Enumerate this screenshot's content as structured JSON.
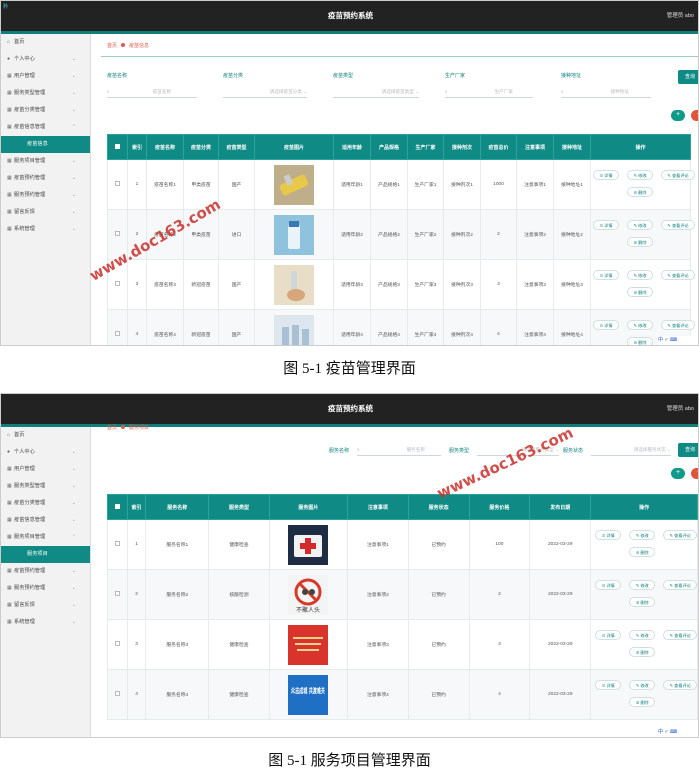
{
  "app": {
    "title": "疫苗预约系统",
    "user": "管理员 abo",
    "corner_mark": "矜"
  },
  "sidebar": {
    "items": [
      {
        "label": "首页",
        "icon": "home-icon",
        "glyph": "⌂"
      },
      {
        "label": "个人中心",
        "icon": "person-icon",
        "glyph": "●"
      },
      {
        "label": "用户管理",
        "icon": "grid-icon",
        "glyph": "▦"
      },
      {
        "label": "服务类型管理",
        "icon": "grid-icon",
        "glyph": "▦"
      },
      {
        "label": "疫苗分类管理",
        "icon": "grid-icon",
        "glyph": "▦"
      },
      {
        "label": "疫苗信息管理",
        "icon": "grid-icon",
        "glyph": "▦"
      },
      {
        "label": "服务项目管理",
        "icon": "grid-icon",
        "glyph": "▦"
      },
      {
        "label": "疫苗预约管理",
        "icon": "grid-icon",
        "glyph": "▦"
      },
      {
        "label": "服务预约管理",
        "icon": "grid-icon",
        "glyph": "▦"
      },
      {
        "label": "留言反馈",
        "icon": "grid-icon",
        "glyph": "▦"
      },
      {
        "label": "系统管理",
        "icon": "grid-icon",
        "glyph": "▦"
      }
    ],
    "sub_vaccine": "疫苗信息",
    "sub_service": "服务项目"
  },
  "screen1": {
    "breadcrumb": {
      "home": "首页",
      "current": "疫苗信息"
    },
    "filters": [
      {
        "label": "疫苗名称",
        "placeholder": "疫苗名称"
      },
      {
        "label": "疫苗分类",
        "placeholder": "请选择疫苗分类"
      },
      {
        "label": "疫苗类型",
        "placeholder": "请选择疫苗类型"
      },
      {
        "label": "生产厂家",
        "placeholder": "生产厂家"
      },
      {
        "label": "接种地址",
        "placeholder": "接种地址"
      }
    ],
    "query_button": "查询",
    "add_button": "+",
    "delete_button": "-",
    "columns": [
      "",
      "索引",
      "疫苗名称",
      "疫苗分类",
      "疫苗类型",
      "疫苗图片",
      "适用年龄",
      "产品规格",
      "生产厂家",
      "接种剂次",
      "疫苗总价",
      "注意事项",
      "接种地址",
      "操作"
    ],
    "rows": [
      [
        "1",
        "疫苗名称1",
        "甲类疫苗",
        "国产",
        "适用年龄1",
        "产品规格1",
        "生产厂家1",
        "接种剂次1",
        "1000",
        "注意事项1",
        "接种地址1"
      ],
      [
        "2",
        "疫苗名称2",
        "甲类疫苗",
        "进口",
        "适用年龄2",
        "产品规格2",
        "生产厂家2",
        "接种剂次2",
        "2",
        "注意事项2",
        "接种地址2"
      ],
      [
        "3",
        "疫苗名称3",
        "新冠疫苗",
        "国产",
        "适用年龄3",
        "产品规格3",
        "生产厂家3",
        "接种剂次3",
        "3",
        "注意事项3",
        "接种地址3"
      ],
      [
        "4",
        "疫苗名称4",
        "新冠疫苗",
        "国产",
        "适用年龄4",
        "产品规格4",
        "生产厂家4",
        "接种剂次4",
        "4",
        "注意事项4",
        "接种地址4"
      ]
    ]
  },
  "screen2": {
    "breadcrumb": {
      "home": "首页",
      "current": "服务项目"
    },
    "filters": [
      {
        "label": "服务名称",
        "placeholder": "服务名称"
      },
      {
        "label": "服务类型",
        "placeholder": "请选择服务类型"
      },
      {
        "label": "服务状态",
        "placeholder": "请选择服务状态"
      }
    ],
    "query_button": "查询",
    "add_button": "+",
    "delete_button": "-",
    "columns": [
      "",
      "索引",
      "服务名称",
      "服务类型",
      "服务图片",
      "注意事项",
      "服务状态",
      "服务价格",
      "发布日期",
      "操作"
    ],
    "rows": [
      [
        "1",
        "服务名称1",
        "健康检查",
        "注意事项1",
        "已预约",
        "100",
        "2022-03-29"
      ],
      [
        "2",
        "服务名称2",
        "核酸检测",
        "注意事项2",
        "已预约",
        "2",
        "2022-03-29"
      ],
      [
        "3",
        "服务名称3",
        "健康检查",
        "注意事项3",
        "已预约",
        "3",
        "2022-03-29"
      ],
      [
        "4",
        "服务名称4",
        "健康检查",
        "注意事项4",
        "已预约",
        "4",
        "2022-03-29"
      ]
    ],
    "image_texts": [
      "不聚人头",
      "众志成城 共渡难关"
    ]
  },
  "ops": {
    "detail": "⊙ 详情",
    "edit": "✎ 修改",
    "view": "✎ 查看评论",
    "delete": "⊘ 删除"
  },
  "tray": "中 ✓ ⌨",
  "watermark": "www.doc163.com",
  "captions": {
    "fig1": "图 5-1 疫苗管理界面",
    "fig2": "图 5-1 服务项目管理界面"
  },
  "colors": {
    "primary": "#0f8a84",
    "topbar": "#222222",
    "danger": "#e2533c",
    "watermark": "#c9302c"
  }
}
